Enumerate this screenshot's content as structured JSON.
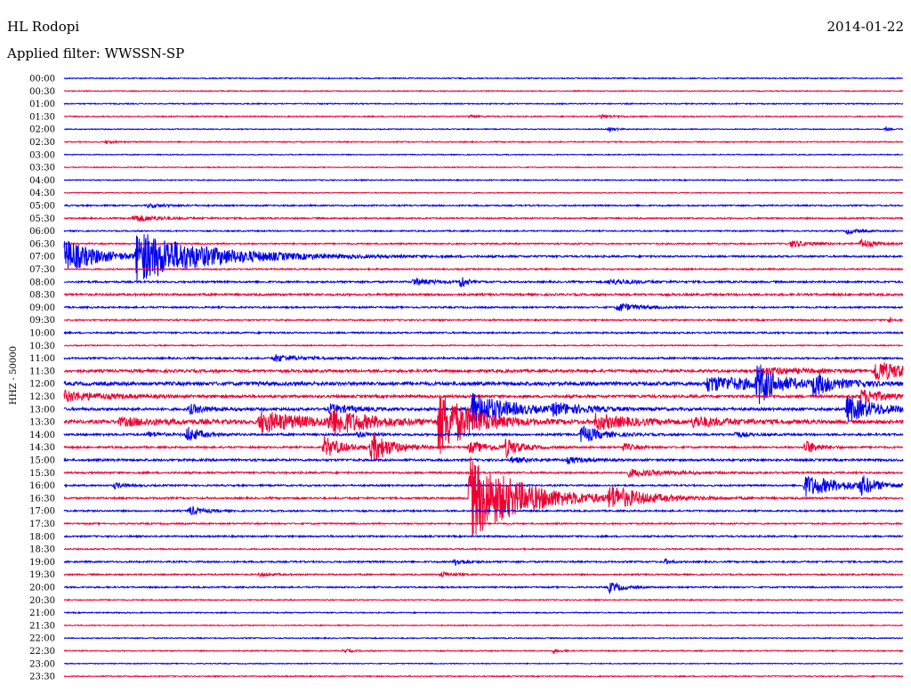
{
  "header": {
    "station": "HL Rodopi",
    "filter": "Applied filter: WWSSN-SP",
    "date": "2014-01-22"
  },
  "axis": {
    "channel_label": "HHZ - 50000"
  },
  "colors": {
    "even_trace": "#0000ee",
    "odd_trace": "#ee0033",
    "background": "#ffffff",
    "text": "#000000"
  },
  "chart_data": {
    "type": "helicorder",
    "x_unit": "minutes within 30-minute row",
    "x_range": [
      0,
      30
    ],
    "rows": [
      {
        "time": "00:00",
        "noise": 0.6,
        "events": []
      },
      {
        "time": "00:30",
        "noise": 0.5,
        "events": []
      },
      {
        "time": "01:00",
        "noise": 0.6,
        "events": []
      },
      {
        "time": "01:30",
        "noise": 0.6,
        "events": [
          {
            "minute": 14.5,
            "amp": 1.5,
            "dur": 0.8
          },
          {
            "minute": 19.2,
            "amp": 2.5,
            "dur": 1.0
          }
        ]
      },
      {
        "time": "02:00",
        "noise": 0.5,
        "events": [
          {
            "minute": 19.5,
            "amp": 2,
            "dur": 0.7
          },
          {
            "minute": 29.4,
            "amp": 2,
            "dur": 0.3
          }
        ]
      },
      {
        "time": "02:30",
        "noise": 0.6,
        "events": [
          {
            "minute": 1.5,
            "amp": 2,
            "dur": 0.6
          }
        ]
      },
      {
        "time": "03:00",
        "noise": 0.5,
        "events": []
      },
      {
        "time": "03:30",
        "noise": 0.5,
        "events": []
      },
      {
        "time": "04:00",
        "noise": 0.6,
        "events": []
      },
      {
        "time": "04:30",
        "noise": 0.5,
        "events": []
      },
      {
        "time": "05:00",
        "noise": 0.8,
        "events": [
          {
            "minute": 3,
            "amp": 2,
            "dur": 1.5
          },
          {
            "minute": 33,
            "amp": 3,
            "dur": 1.0
          }
        ]
      },
      {
        "time": "05:30",
        "noise": 0.8,
        "events": [
          {
            "minute": 2.5,
            "amp": 4,
            "dur": 2.0
          },
          {
            "minute": 35,
            "amp": 14,
            "dur": 1.0
          }
        ]
      },
      {
        "time": "06:00",
        "noise": 0.7,
        "events": [
          {
            "minute": 28,
            "amp": 3,
            "dur": 1.0
          },
          {
            "minute": 35,
            "amp": 28,
            "dur": 1.5
          }
        ]
      },
      {
        "time": "06:30",
        "noise": 0.8,
        "events": [
          {
            "minute": 26,
            "amp": 4,
            "dur": 1.5
          },
          {
            "minute": 28.5,
            "amp": 5,
            "dur": 1.0
          },
          {
            "minute": 31,
            "amp": 8,
            "dur": 1.5
          },
          {
            "minute": 33,
            "amp": 10,
            "dur": 1.5
          },
          {
            "minute": 35,
            "amp": 24,
            "dur": 1.5
          }
        ]
      },
      {
        "time": "07:00",
        "noise": 1.0,
        "events": [
          {
            "minute": 0,
            "amp": 20,
            "dur": 2.5
          },
          {
            "minute": 2.6,
            "amp": 28,
            "dur": 5.5
          }
        ]
      },
      {
        "time": "07:30",
        "noise": 0.8,
        "events": []
      },
      {
        "time": "08:00",
        "noise": 1.0,
        "events": [
          {
            "minute": 12.5,
            "amp": 4,
            "dur": 1.5
          },
          {
            "minute": 14.2,
            "amp": 10,
            "dur": 0.3
          },
          {
            "minute": 19.5,
            "amp": 3,
            "dur": 2.0
          }
        ]
      },
      {
        "time": "08:30",
        "noise": 1.2,
        "events": []
      },
      {
        "time": "09:00",
        "noise": 0.9,
        "events": [
          {
            "minute": 19.8,
            "amp": 5,
            "dur": 1.5
          }
        ]
      },
      {
        "time": "09:30",
        "noise": 0.8,
        "events": [
          {
            "minute": 29.5,
            "amp": 3,
            "dur": 0.5
          }
        ]
      },
      {
        "time": "10:00",
        "noise": 0.9,
        "events": []
      },
      {
        "time": "10:30",
        "noise": 0.6,
        "events": []
      },
      {
        "time": "11:00",
        "noise": 1.0,
        "events": [
          {
            "minute": 7.5,
            "amp": 4,
            "dur": 2.0
          }
        ]
      },
      {
        "time": "11:30",
        "noise": 1.5,
        "events": [
          {
            "minute": 25,
            "amp": 4,
            "dur": 3.0
          },
          {
            "minute": 29,
            "amp": 12,
            "dur": 2.5
          },
          {
            "minute": 33,
            "amp": 10,
            "dur": 1.5
          }
        ]
      },
      {
        "time": "12:00",
        "noise": 2.0,
        "events": [
          {
            "minute": 23,
            "amp": 8,
            "dur": 5.5
          },
          {
            "minute": 24.8,
            "amp": 22,
            "dur": 1.2
          },
          {
            "minute": 26.8,
            "amp": 12,
            "dur": 1.5
          },
          {
            "minute": 31,
            "amp": 10,
            "dur": 2.0
          },
          {
            "minute": 34,
            "amp": 10,
            "dur": 2.0
          }
        ]
      },
      {
        "time": "12:30",
        "noise": 1.5,
        "events": [
          {
            "minute": 0,
            "amp": 6,
            "dur": 3.0
          },
          {
            "minute": 28.5,
            "amp": 8,
            "dur": 2.0
          },
          {
            "minute": 31.5,
            "amp": 8,
            "dur": 2.0
          }
        ]
      },
      {
        "time": "13:00",
        "noise": 1.5,
        "events": [
          {
            "minute": 4.5,
            "amp": 5,
            "dur": 1.5
          },
          {
            "minute": 9.5,
            "amp": 5,
            "dur": 2.0
          },
          {
            "minute": 14.6,
            "amp": 22,
            "dur": 2.5
          },
          {
            "minute": 17.5,
            "amp": 6,
            "dur": 2.5
          },
          {
            "minute": 28,
            "amp": 14,
            "dur": 2.5
          },
          {
            "minute": 30.5,
            "amp": 16,
            "dur": 2.0
          }
        ]
      },
      {
        "time": "13:30",
        "noise": 2.0,
        "events": [
          {
            "minute": 2,
            "amp": 4,
            "dur": 4.0
          },
          {
            "minute": 7,
            "amp": 12,
            "dur": 3.5
          },
          {
            "minute": 9.5,
            "amp": 14,
            "dur": 3.0
          },
          {
            "minute": 13.4,
            "amp": 36,
            "dur": 2.5
          },
          {
            "minute": 19,
            "amp": 8,
            "dur": 3.0
          },
          {
            "minute": 22.5,
            "amp": 5,
            "dur": 3.0
          }
        ]
      },
      {
        "time": "14:00",
        "noise": 1.2,
        "events": [
          {
            "minute": 3,
            "amp": 3,
            "dur": 1.0
          },
          {
            "minute": 4.4,
            "amp": 9,
            "dur": 1.0
          },
          {
            "minute": 10.5,
            "amp": 3,
            "dur": 1.0
          },
          {
            "minute": 18.5,
            "amp": 10,
            "dur": 1.5
          },
          {
            "minute": 24,
            "amp": 3,
            "dur": 1.0
          }
        ]
      },
      {
        "time": "14:30",
        "noise": 1.0,
        "events": [
          {
            "minute": 9.3,
            "amp": 12,
            "dur": 1.5
          },
          {
            "minute": 11,
            "amp": 18,
            "dur": 1.5
          },
          {
            "minute": 14.5,
            "amp": 6,
            "dur": 2.0
          },
          {
            "minute": 15.8,
            "amp": 10,
            "dur": 1.0
          },
          {
            "minute": 20,
            "amp": 4,
            "dur": 1.0
          },
          {
            "minute": 26.5,
            "amp": 8,
            "dur": 1.0
          }
        ]
      },
      {
        "time": "15:00",
        "noise": 1.2,
        "events": [
          {
            "minute": 16,
            "amp": 3,
            "dur": 1.5
          },
          {
            "minute": 18,
            "amp": 3,
            "dur": 1.5
          }
        ]
      },
      {
        "time": "15:30",
        "noise": 1.0,
        "events": [
          {
            "minute": 20.2,
            "amp": 4,
            "dur": 3.0
          }
        ]
      },
      {
        "time": "16:00",
        "noise": 0.9,
        "events": [
          {
            "minute": 1.8,
            "amp": 3,
            "dur": 1.0
          },
          {
            "minute": 26.5,
            "amp": 12,
            "dur": 3.0
          },
          {
            "minute": 28.5,
            "amp": 10,
            "dur": 1.0
          }
        ]
      },
      {
        "time": "16:30",
        "noise": 1.0,
        "events": [
          {
            "minute": 14.5,
            "amp": 48,
            "dur": 4.0
          },
          {
            "minute": 19.5,
            "amp": 12,
            "dur": 2.5
          }
        ]
      },
      {
        "time": "17:00",
        "noise": 0.9,
        "events": [
          {
            "minute": 4.5,
            "amp": 5,
            "dur": 1.0
          }
        ]
      },
      {
        "time": "17:30",
        "noise": 0.8,
        "events": []
      },
      {
        "time": "18:00",
        "noise": 0.9,
        "events": [
          {
            "minute": 32,
            "amp": 3,
            "dur": 0.5
          }
        ]
      },
      {
        "time": "18:30",
        "noise": 0.7,
        "events": []
      },
      {
        "time": "19:00",
        "noise": 0.9,
        "events": [
          {
            "minute": 14,
            "amp": 4,
            "dur": 0.8
          },
          {
            "minute": 21.5,
            "amp": 3,
            "dur": 0.5
          }
        ]
      },
      {
        "time": "19:30",
        "noise": 0.8,
        "events": [
          {
            "minute": 7,
            "amp": 2,
            "dur": 1.0
          },
          {
            "minute": 13.5,
            "amp": 3,
            "dur": 1.0
          }
        ]
      },
      {
        "time": "20:00",
        "noise": 0.8,
        "events": [
          {
            "minute": 19.5,
            "amp": 6,
            "dur": 1.0
          }
        ]
      },
      {
        "time": "20:30",
        "noise": 0.6,
        "events": []
      },
      {
        "time": "21:00",
        "noise": 0.6,
        "events": []
      },
      {
        "time": "21:30",
        "noise": 0.5,
        "events": []
      },
      {
        "time": "22:00",
        "noise": 0.6,
        "events": []
      },
      {
        "time": "22:30",
        "noise": 0.6,
        "events": [
          {
            "minute": 10,
            "amp": 2,
            "dur": 0.6
          },
          {
            "minute": 17.5,
            "amp": 2,
            "dur": 0.6
          }
        ]
      },
      {
        "time": "23:00",
        "noise": 0.5,
        "events": []
      },
      {
        "time": "23:30",
        "noise": 0.6,
        "events": []
      }
    ]
  }
}
